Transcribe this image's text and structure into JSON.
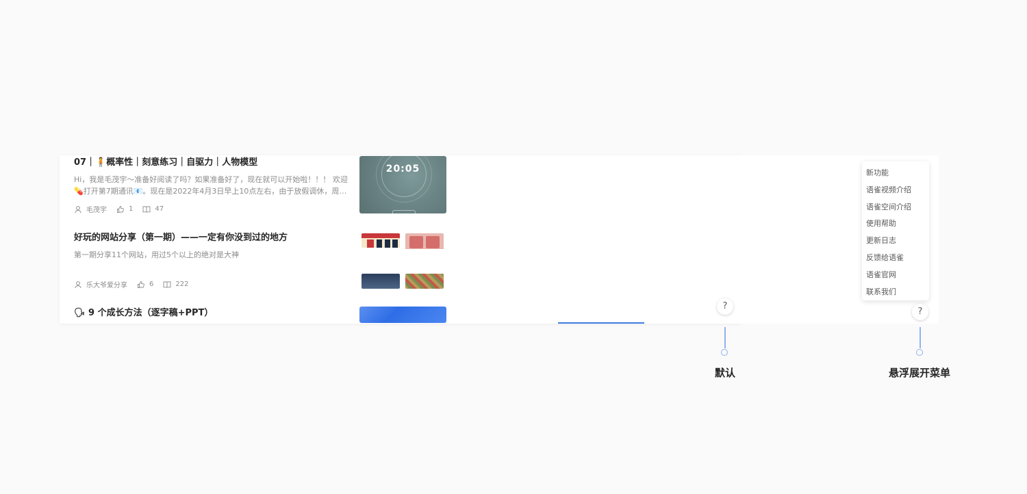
{
  "articles": [
    {
      "title": "07｜🧍概率性｜刻意练习｜自驱力｜人物模型",
      "summary": "Hi，我是毛茂宇～准备好阅读了吗？如果准备好了，现在就可以开始啦！！！ 欢迎💊打开第7期通讯📧。现在是2022年4月3日早上10点左右，由于放假调休，周…",
      "author": "毛茂宇",
      "likes": "1",
      "reads": "47",
      "thumb_clock": "20:05"
    },
    {
      "title": "好玩的网站分享（第一期）——一定有你没到过的地方",
      "summary": "第一期分享11个网站，用过5个以上的绝对是大神",
      "author": "乐大爷爱分享",
      "likes": "6",
      "reads": "222"
    },
    {
      "title": "🗣 9 个成长方法（逐字稿+PPT）"
    }
  ],
  "icons": {
    "author": "user-icon",
    "likes": "thumbs-up-icon",
    "reads": "book-icon"
  },
  "help_button": {
    "label": "?"
  },
  "help_menu": {
    "items": [
      "新功能",
      "语雀视频介绍",
      "语雀空间介绍",
      "使用帮助",
      "更新日志",
      "反馈给语雀",
      "语雀官网",
      "联系我们"
    ]
  },
  "callouts": {
    "default_label": "默认",
    "hover_label": "悬浮展开菜单"
  },
  "colors": {
    "accent": "#3f7be3",
    "callout_line": "#8fb3f0",
    "text_primary": "#262626",
    "text_secondary": "#8c8c8c"
  }
}
